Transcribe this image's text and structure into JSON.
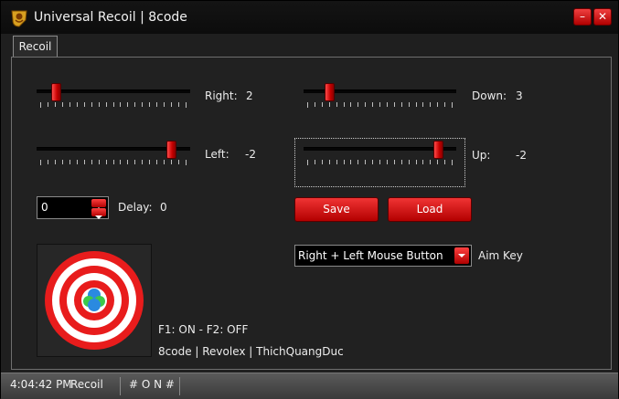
{
  "window": {
    "title": "Universal Recoil | 8code",
    "minimize_glyph": "–",
    "close_glyph": "✕"
  },
  "tabs": [
    {
      "label": "Recoil"
    }
  ],
  "sliders": {
    "right": {
      "label": "Right:",
      "value": "2"
    },
    "left": {
      "label": "Left:",
      "value": "-2"
    },
    "down": {
      "label": "Down:",
      "value": "3"
    },
    "up": {
      "label": "Up:",
      "value": "-2"
    }
  },
  "delay": {
    "input_value": "0",
    "label": "Delay:",
    "value": "0"
  },
  "buttons": {
    "save": "Save",
    "load": "Load"
  },
  "aim_key": {
    "selected": "Right + Left Mouse Button",
    "label": "Aim Key"
  },
  "hotkey_info": "F1: ON - F2: OFF",
  "credits": "8code | Revolex | ThichQuangDuc",
  "statusbar": {
    "time": "4:04:42 PM",
    "mode": "Recoil",
    "state": "# O N #"
  },
  "colors": {
    "accent": "#d40000",
    "background": "#212121"
  }
}
